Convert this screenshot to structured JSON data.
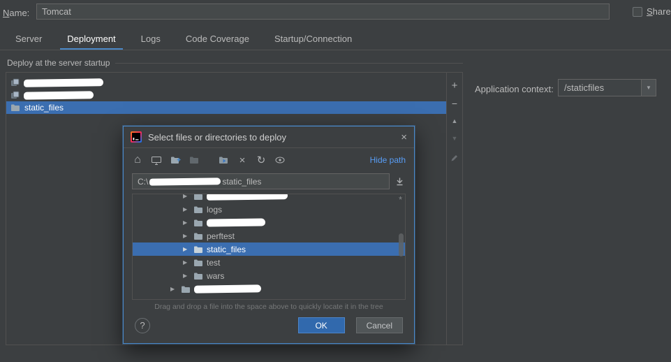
{
  "colors": {
    "selection_blue": "#3b6eb0",
    "tab_accent": "#4a88c7",
    "link_blue": "#589df6",
    "ok_button": "#3169ad",
    "background": "#3c3f41"
  },
  "icons": {
    "plus": "+",
    "minus": "−",
    "up": "▲",
    "down": "▼",
    "home": "⌂",
    "close": "×",
    "refresh": "↻",
    "combo_arrow": "▼",
    "tree_arrow": "▶",
    "asterisk": "*"
  },
  "header": {
    "name_label": "Name:",
    "name_value": "Tomcat",
    "share_label": "Share"
  },
  "tabs": {
    "active": "Deployment",
    "items": [
      {
        "label": "Server"
      },
      {
        "label": "Deployment"
      },
      {
        "label": "Logs"
      },
      {
        "label": "Code Coverage"
      },
      {
        "label": "Startup/Connection"
      }
    ]
  },
  "deploy": {
    "section_title": "Deploy at the server startup",
    "list": [
      {
        "redacted": true
      },
      {
        "redacted": true
      },
      {
        "label": "static_files",
        "selected": true
      }
    ],
    "app_context": {
      "label": "Application context:",
      "value": "/staticfiles"
    }
  },
  "dialog": {
    "title": "Select files or directories to deploy",
    "hide_path_label": "Hide path",
    "path": {
      "prefix": "C:\\",
      "suffix": "static_files"
    },
    "tree": {
      "rows": [
        {
          "redacted": true,
          "partial": true
        },
        {
          "label": "logs"
        },
        {
          "redacted": true
        },
        {
          "label": "perftest"
        },
        {
          "label": "static_files",
          "selected": true
        },
        {
          "label": "test"
        },
        {
          "label": "wars"
        },
        {
          "redacted": true,
          "outdented": true
        }
      ],
      "hint": "Drag and drop a file into the space above to quickly locate it in the tree"
    },
    "buttons": {
      "help": "?",
      "ok": "OK",
      "cancel": "Cancel"
    }
  }
}
